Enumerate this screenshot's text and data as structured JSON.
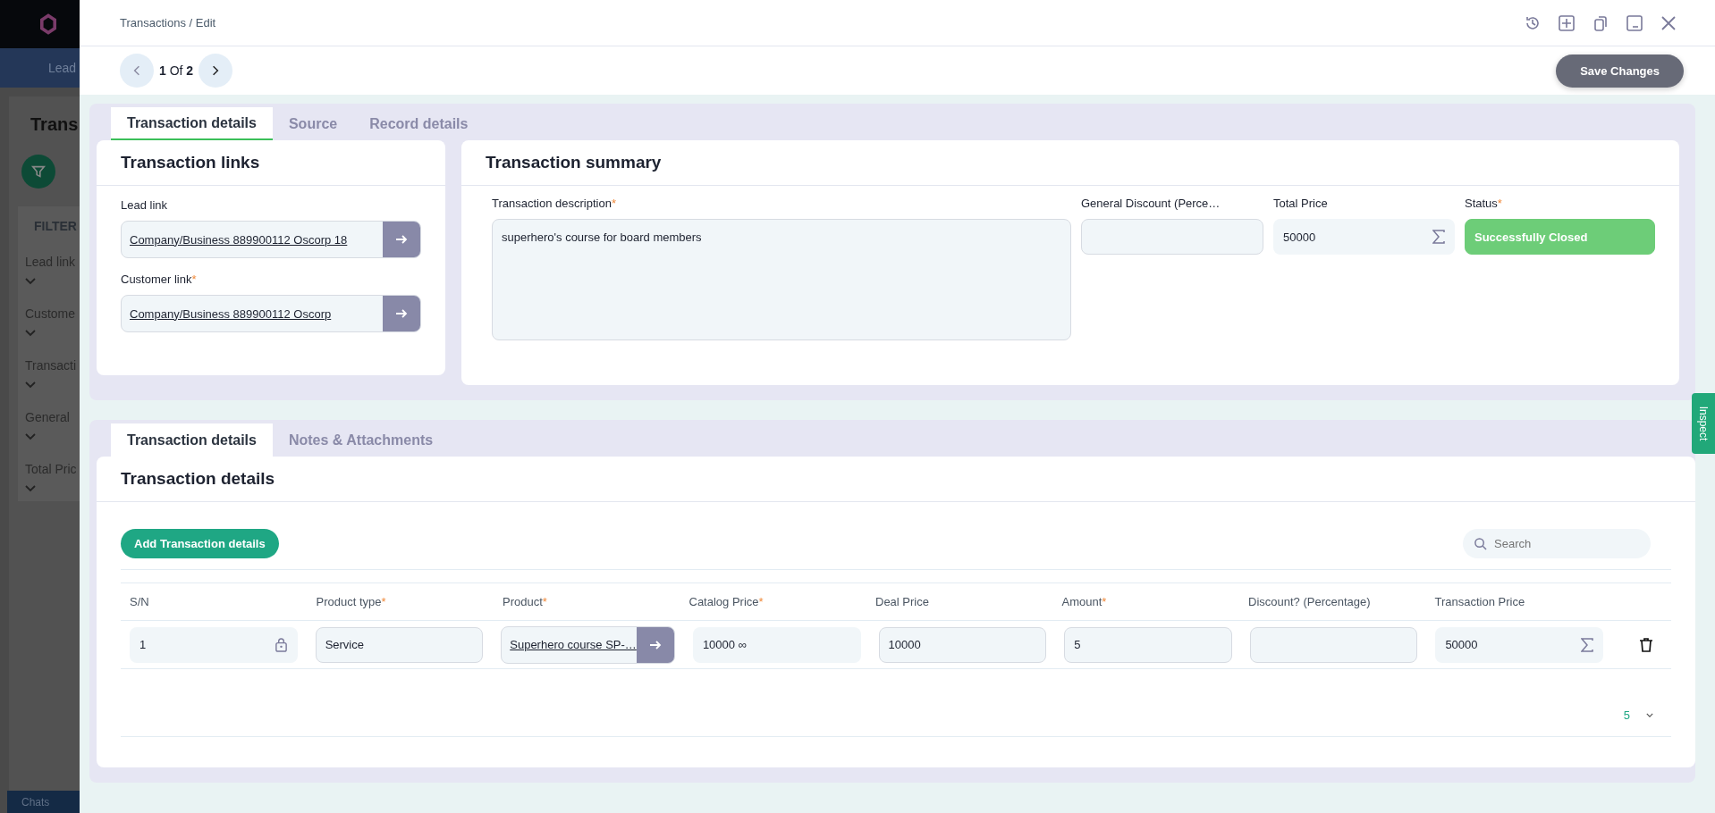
{
  "background_app": {
    "nav_item": "Lead",
    "page_title": "Trans",
    "filters_title": "FILTER",
    "filter_labels": [
      "Lead link",
      "Custome",
      "Transacti",
      "General",
      "Total Pric"
    ],
    "chats": "Chats"
  },
  "header": {
    "breadcrumb": "Transactions / Edit"
  },
  "pager": {
    "current": "1",
    "separator": "Of",
    "total": "2"
  },
  "save_button": "Save Changes",
  "top_tabs": [
    {
      "label": "Transaction details",
      "selected": true
    },
    {
      "label": "Source",
      "selected": false
    },
    {
      "label": "Record details",
      "selected": false
    }
  ],
  "links_card": {
    "title": "Transaction links",
    "fields": [
      {
        "label": "Lead link",
        "required": false,
        "value": "Company/Business 889900112 Oscorp 18"
      },
      {
        "label": "Customer link",
        "required": true,
        "value": "Company/Business 889900112 Oscorp"
      }
    ]
  },
  "summary_card": {
    "title": "Transaction summary",
    "fields": [
      {
        "kind": "textarea",
        "label": "Transaction description",
        "required": true,
        "value": "superhero's course for board members"
      },
      {
        "kind": "input",
        "label": "General Discount (Perce…",
        "required": false
      },
      {
        "kind": "sum",
        "label": "Total Price",
        "required": false,
        "value": "50000"
      },
      {
        "kind": "status",
        "label": "Status",
        "required": true,
        "value": "Successfully Closed"
      }
    ]
  },
  "bottom_tabs": [
    {
      "label": "Transaction details",
      "selected": true
    },
    {
      "label": "Notes & Attachments",
      "selected": false
    }
  ],
  "details": {
    "title": "Transaction details",
    "add_button": "Add Transaction details",
    "search": {
      "placeholder": "Search"
    },
    "columns": [
      {
        "label": "S/N",
        "required": false
      },
      {
        "label": "Product type",
        "required": true
      },
      {
        "label": "Product",
        "required": true
      },
      {
        "label": "Catalog Price",
        "required": true
      },
      {
        "label": "Deal Price",
        "required": false
      },
      {
        "label": "Amount",
        "required": true
      },
      {
        "label": "Discount? (Percentage)",
        "required": false
      },
      {
        "label": "Transaction Price",
        "required": false
      }
    ],
    "rows": [
      {
        "cells": [
          {
            "kind": "locked",
            "value": "1"
          },
          {
            "kind": "input",
            "value": "Service"
          },
          {
            "kind": "link",
            "value": "Superhero course SP-…"
          },
          {
            "kind": "plain",
            "value": "10000 ∞"
          },
          {
            "kind": "input",
            "value": "10000"
          },
          {
            "kind": "input",
            "value": "5"
          },
          {
            "kind": "input"
          },
          {
            "kind": "sum",
            "value": "50000"
          }
        ]
      }
    ],
    "page_size": "5"
  },
  "inspect_tab": "Inspect",
  "required_mark": "*"
}
